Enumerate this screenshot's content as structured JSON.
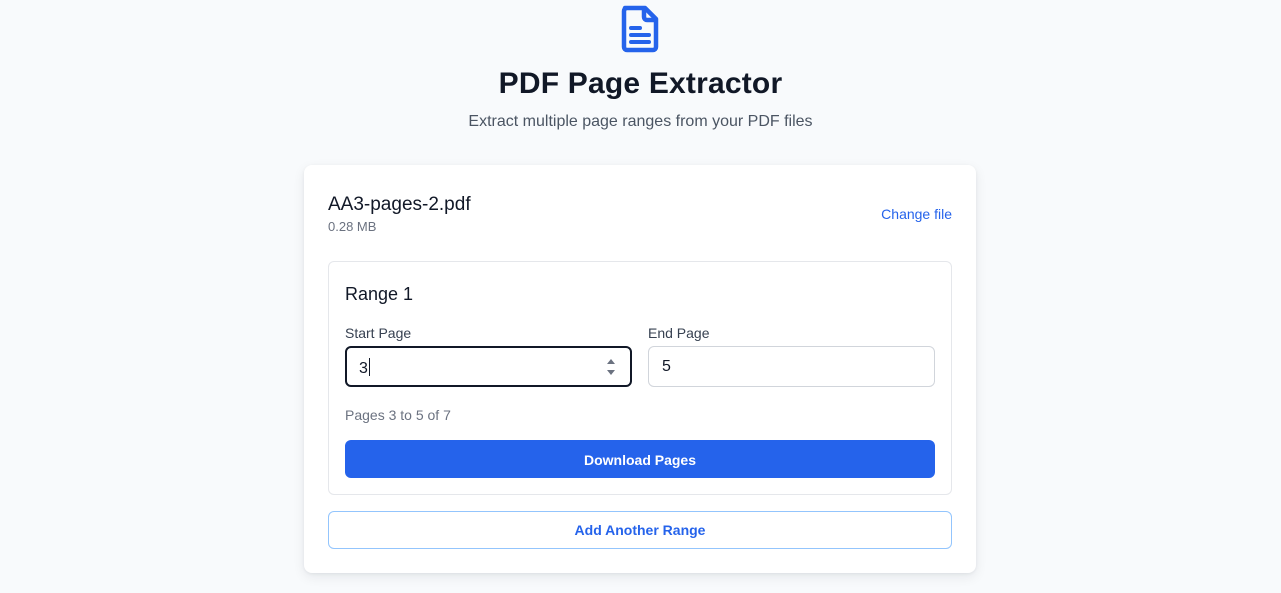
{
  "header": {
    "icon": "document-icon",
    "title": "PDF Page Extractor",
    "subtitle": "Extract multiple page ranges from your PDF files"
  },
  "file": {
    "name": "AA3-pages-2.pdf",
    "size": "0.28 MB",
    "change_label": "Change file"
  },
  "ranges": [
    {
      "title": "Range 1",
      "start_label": "Start Page",
      "start_value": "3",
      "end_label": "End Page",
      "end_value": "5",
      "info": "Pages 3 to 5 of 7",
      "download_label": "Download Pages"
    }
  ],
  "add_range_label": "Add Another Range",
  "colors": {
    "accent": "#2563eb",
    "background": "#f8fafc",
    "title": "#111827"
  }
}
